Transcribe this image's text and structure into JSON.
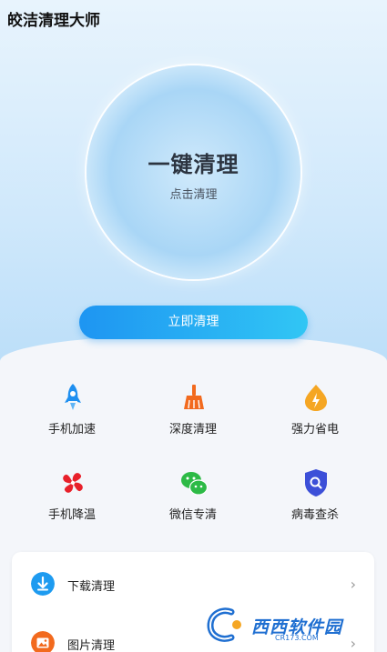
{
  "app": {
    "title": "皎洁清理大师"
  },
  "hero": {
    "main_text": "一键清理",
    "sub_text": "点击清理",
    "button_label": "立即清理"
  },
  "features": [
    {
      "label": "手机加速",
      "icon": "rocket-icon",
      "color": "#1e8ff0"
    },
    {
      "label": "深度清理",
      "icon": "broom-icon",
      "color": "#f26a1e"
    },
    {
      "label": "强力省电",
      "icon": "battery-icon",
      "color": "#f5a623"
    },
    {
      "label": "手机降温",
      "icon": "fan-icon",
      "color": "#e8202a"
    },
    {
      "label": "微信专清",
      "icon": "wechat-icon",
      "color": "#2dba46"
    },
    {
      "label": "病毒查杀",
      "icon": "shield-search-icon",
      "color": "#3c4fd8"
    }
  ],
  "list": [
    {
      "label": "下载清理",
      "icon": "download-icon",
      "color": "#1e9bf0"
    },
    {
      "label": "图片清理",
      "icon": "image-icon",
      "color": "#f26a1e"
    }
  ],
  "watermark": {
    "text": "西西软件园",
    "sub": "CR173.COM"
  }
}
